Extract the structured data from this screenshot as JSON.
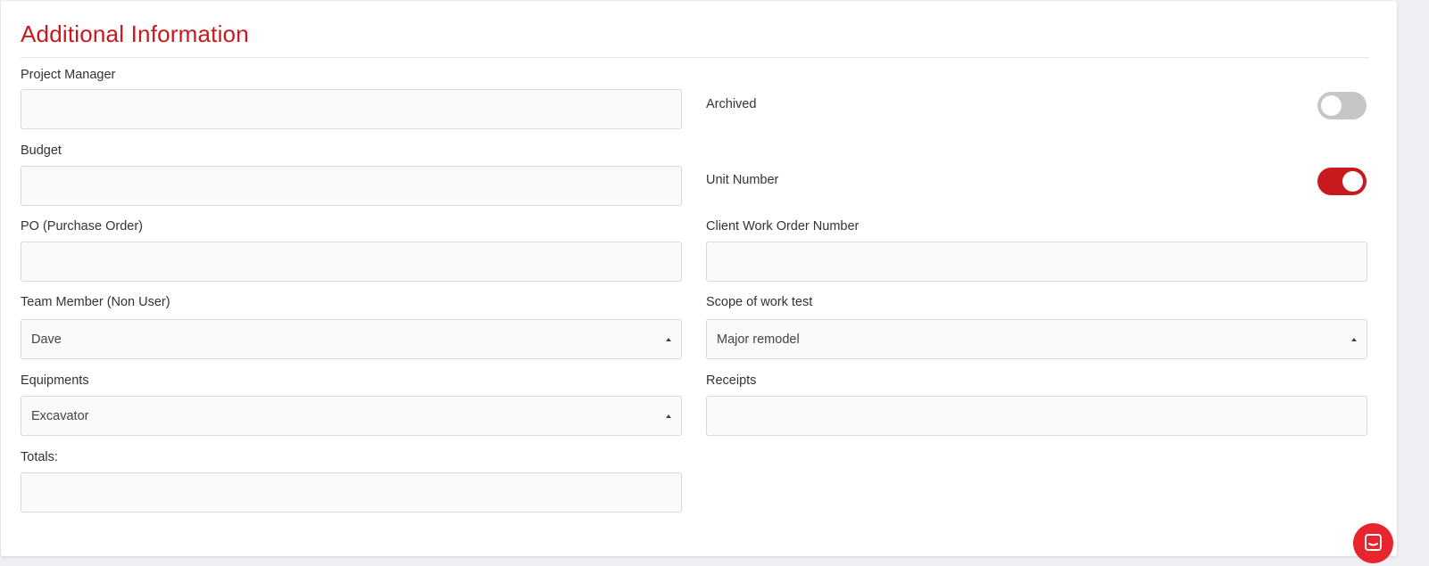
{
  "section": {
    "title": "Additional Information"
  },
  "fields": {
    "project_manager": {
      "label": "Project Manager",
      "value": ""
    },
    "budget": {
      "label": "Budget",
      "value": ""
    },
    "po": {
      "label": "PO (Purchase Order)",
      "value": ""
    },
    "team_member": {
      "label": "Team Member (Non User)",
      "value": "Dave"
    },
    "equipments": {
      "label": "Equipments",
      "value": "Excavator"
    },
    "totals": {
      "label": "Totals:",
      "value": ""
    },
    "archived": {
      "label": "Archived",
      "on": false
    },
    "unit_number": {
      "label": "Unit Number",
      "on": true
    },
    "client_wo": {
      "label": "Client Work Order Number",
      "value": ""
    },
    "scope_of_work": {
      "label": "Scope of work test",
      "value": "Major remodel"
    },
    "receipts": {
      "label": "Receipts",
      "value": ""
    }
  },
  "colors": {
    "accent": "#c8191f",
    "toggle_off": "#c6c6c6",
    "chat_button": "#e8242c"
  },
  "icons": {
    "select_caret": "caret-up-icon",
    "chat": "chat-icon"
  }
}
